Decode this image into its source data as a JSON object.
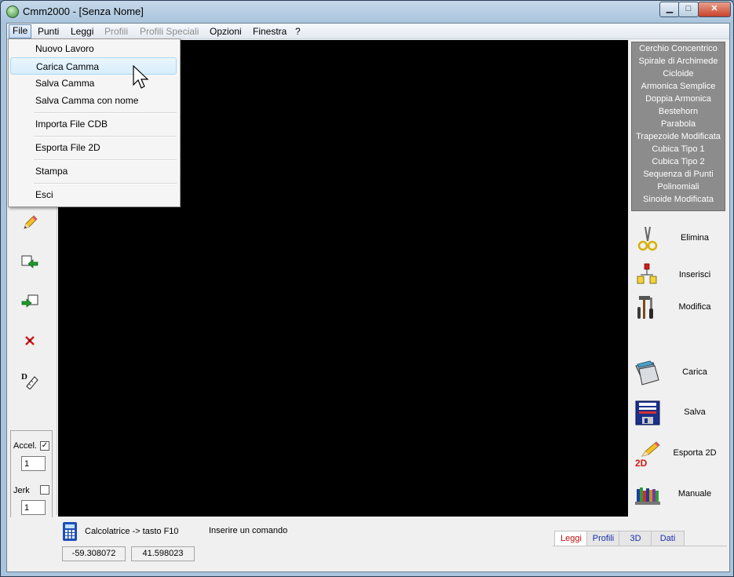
{
  "window": {
    "title": "Cmm2000 - [Senza Nome]",
    "minimize_glyph": "▁",
    "maximize_glyph": "□",
    "close_glyph": "✕"
  },
  "menubar": [
    {
      "label": "File",
      "state": "active"
    },
    {
      "label": "Punti",
      "state": "enabled"
    },
    {
      "label": "Leggi",
      "state": "enabled"
    },
    {
      "label": "Profili",
      "state": "disabled"
    },
    {
      "label": "Profili Speciali",
      "state": "disabled"
    },
    {
      "label": "Opzioni",
      "state": "enabled"
    },
    {
      "label": "Finestra",
      "state": "enabled"
    },
    {
      "label": "?",
      "state": "enabled"
    }
  ],
  "file_menu": [
    {
      "label": "Nuovo Lavoro"
    },
    {
      "label": "Carica Camma",
      "highlighted": true
    },
    {
      "label": "Salva Camma"
    },
    {
      "label": "Salva Camma con nome"
    },
    {
      "label": "Importa File CDB"
    },
    {
      "label": "Esporta File 2D"
    },
    {
      "label": "Stampa"
    },
    {
      "label": "Esci"
    }
  ],
  "left_toolbar": {
    "tools": [
      "pencil-icon",
      "import-points-icon",
      "export-points-icon",
      "delete-point-icon",
      "dimension-icon"
    ],
    "accel_label": "Accel.",
    "accel_checked": true,
    "accel_value": "1",
    "jerk_label": "Jerk",
    "jerk_checked": false,
    "jerk_value": "1"
  },
  "profiles": [
    "Cerchio Concentrico",
    "Spirale di Archimede",
    "Cicloide",
    "Armonica Semplice",
    "Doppia Armonica",
    "Bestehorn",
    "Parabola",
    "Trapezoide Modificata",
    "Cubica Tipo 1",
    "Cubica Tipo 2",
    "Sequenza di Punti",
    "Polinomiali",
    "Sinoide Modificata"
  ],
  "actions": [
    {
      "label": "Elimina",
      "icon": "scissors-icon"
    },
    {
      "label": "Inserisci",
      "icon": "insert-icon"
    },
    {
      "label": "Modifica",
      "icon": "tools-icon"
    },
    {
      "label": "Carica",
      "icon": "folder-icon"
    },
    {
      "label": "Salva",
      "icon": "floppy-icon"
    },
    {
      "label": "Esporta 2D",
      "icon": "export-2d-icon",
      "badge": "2D"
    },
    {
      "label": "Manuale",
      "icon": "books-icon"
    }
  ],
  "status": {
    "calculator_hint": "Calcolatrice -> tasto F10",
    "command_prompt": "Inserire un comando",
    "coord_x": "-59.308072",
    "coord_y": "41.598023"
  },
  "tabs": [
    {
      "label": "Leggi",
      "active": true
    },
    {
      "label": "Profili",
      "active": false
    },
    {
      "label": "3D",
      "active": false
    },
    {
      "label": "Dati",
      "active": false
    }
  ],
  "colors": {
    "canvas": "#000000",
    "profile_panel": "#8c8c8c",
    "active_tab_text": "#c01010",
    "tab_text": "#1a2faa"
  }
}
